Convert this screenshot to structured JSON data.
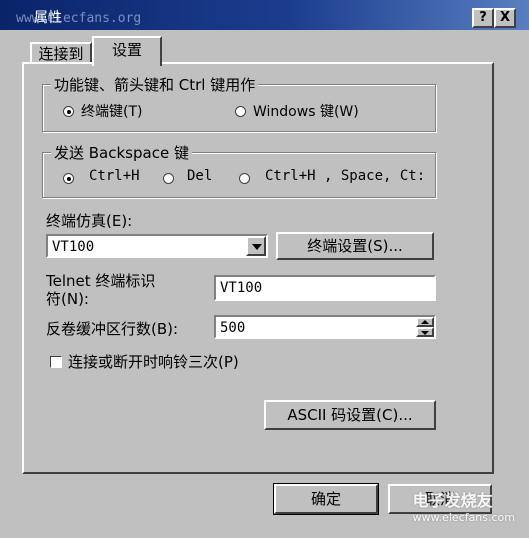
{
  "window": {
    "title": "属性",
    "watermark_top": "www.elecfans.org",
    "help_button": "?",
    "close_button": "X"
  },
  "tabs": [
    {
      "label": "连接到",
      "active": false
    },
    {
      "label": "设置",
      "active": true
    }
  ],
  "function_keys_group": {
    "legend": "功能键、箭头键和 Ctrl 键用作",
    "options": [
      {
        "label": "终端键(T)",
        "selected": true
      },
      {
        "label": "Windows 键(W)",
        "selected": false
      }
    ]
  },
  "backspace_group": {
    "legend": "发送 Backspace 键",
    "options": [
      {
        "label": "Ctrl+H",
        "selected": true
      },
      {
        "label": "Del",
        "selected": false
      },
      {
        "label": "Ctrl+H , Space, Ct:",
        "selected": false
      }
    ]
  },
  "emulation": {
    "label": "终端仿真(E):",
    "value": "VT100",
    "settings_button": "终端设置(S)..."
  },
  "telnet_id": {
    "label_line1": "Telnet 终端标识",
    "label_line2": "符(N):",
    "value": "VT100"
  },
  "backscroll": {
    "label": "反卷缓冲区行数(B):",
    "value": "500"
  },
  "beep_option": {
    "label": "连接或断开时响铃三次(P)",
    "checked": false
  },
  "ascii_button": "ASCII 码设置(C)...",
  "ok_button": "确定",
  "cancel_button": "取消",
  "watermark_bottom": "电子发烧友",
  "watermark_url": "www.elecfans.com"
}
